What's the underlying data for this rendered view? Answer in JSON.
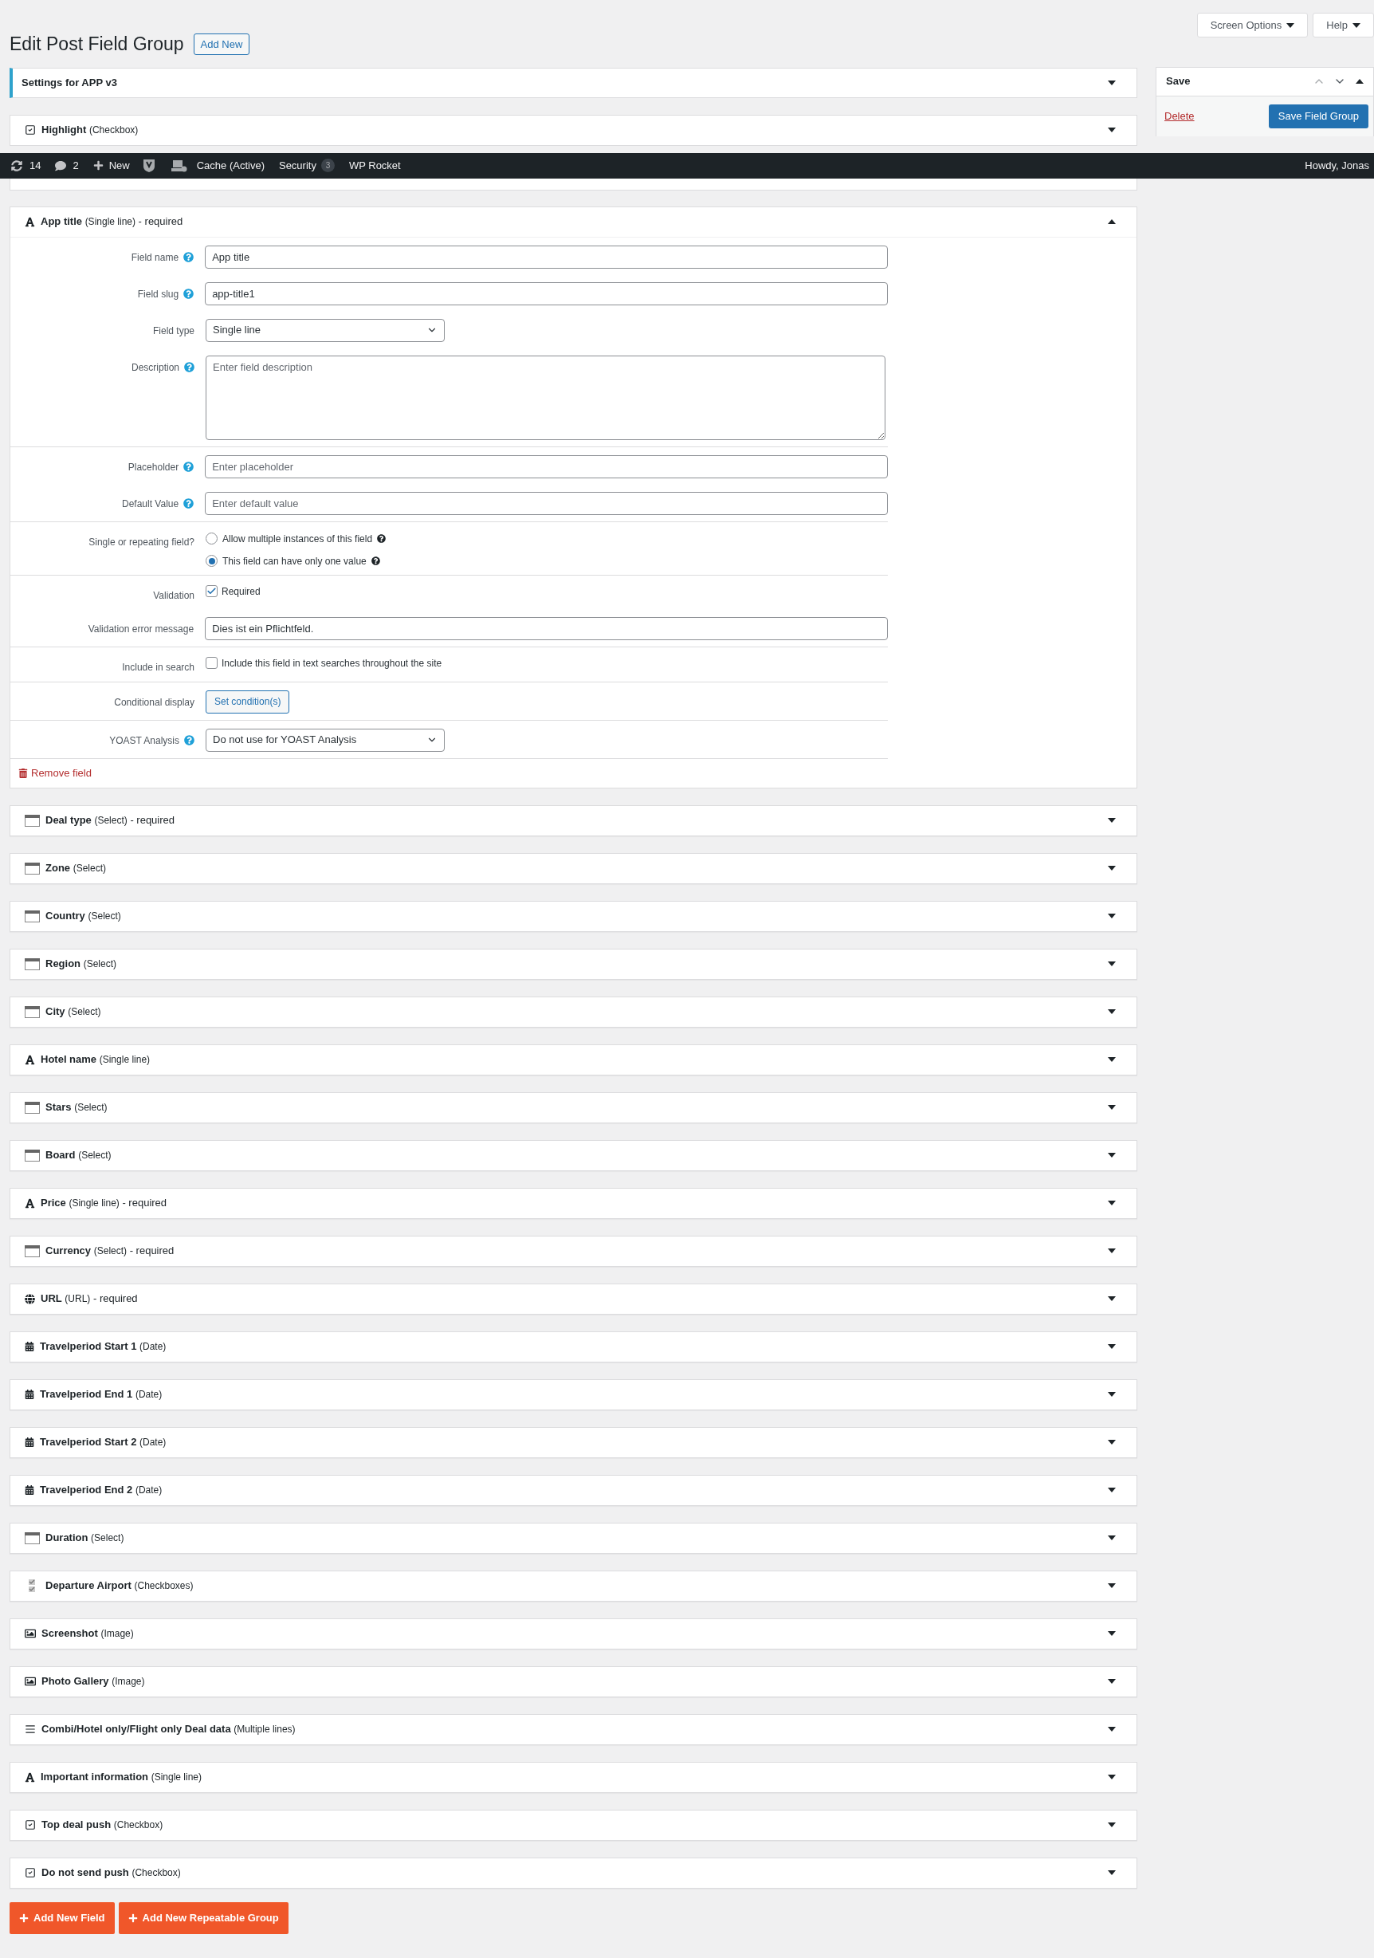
{
  "screen_meta": {
    "screen_options": "Screen Options",
    "help": "Help"
  },
  "page_title": "Edit Post Field Group",
  "add_new": "Add New",
  "settings_box": {
    "title": "Settings for APP v3",
    "expanded": false
  },
  "top_fields": [
    {
      "kind": "checkbox",
      "name": "Highlight",
      "type": "(Checkbox)",
      "expanded": false
    }
  ],
  "save_box": {
    "title": "Save",
    "delete": "Delete",
    "button": "Save Field Group"
  },
  "admin_bar": {
    "updates": "14",
    "comments": "2",
    "new": "New",
    "cache": "Cache (Active)",
    "security": "Security",
    "security_count": "3",
    "rocket": "WP Rocket",
    "greeting": "Howdy, Jonas"
  },
  "active_field": {
    "kind": "text",
    "name": "App title",
    "type": "(Single line)",
    "suffix": "- required",
    "expanded": true,
    "groups": [
      [
        {
          "kind": "input",
          "label": "Field name",
          "help": true,
          "value": "App title"
        },
        {
          "kind": "input",
          "label": "Field slug",
          "help": true,
          "value": "app-title1"
        },
        {
          "kind": "select",
          "label": "Field type",
          "help": false,
          "value": "Single line"
        },
        {
          "kind": "textarea",
          "label": "Description",
          "help": true,
          "placeholder": "Enter field description"
        }
      ],
      [
        {
          "kind": "input",
          "label": "Placeholder",
          "help": true,
          "placeholder": "Enter placeholder"
        },
        {
          "kind": "input",
          "label": "Default Value",
          "help": true,
          "placeholder": "Enter default value"
        }
      ],
      [
        {
          "kind": "radios",
          "label": "Single or repeating field?",
          "help": false,
          "options": [
            {
              "label": "Allow multiple instances of this field",
              "help": true,
              "selected": false
            },
            {
              "label": "This field can have only one value",
              "help": true,
              "selected": true
            }
          ]
        }
      ],
      [
        {
          "kind": "checkbox",
          "label": "Validation",
          "help": false,
          "text": "Required",
          "checked": true
        },
        {
          "kind": "input",
          "label": "Validation error message",
          "help": false,
          "value": "Dies ist ein Pflichtfeld."
        }
      ],
      [
        {
          "kind": "checkbox",
          "label": "Include in search",
          "help": false,
          "text": "Include this field in text searches throughout the site",
          "checked": false
        }
      ],
      [
        {
          "kind": "button",
          "label": "Conditional display",
          "help": false,
          "text": "Set condition(s)"
        }
      ],
      [
        {
          "kind": "select",
          "label": "YOAST Analysis",
          "help": true,
          "value": "Do not use for YOAST Analysis"
        }
      ]
    ],
    "remove": "Remove field"
  },
  "fields": [
    {
      "kind": "select",
      "name": "Deal type",
      "type": "(Select)",
      "suffix": "- required",
      "expanded": false
    },
    {
      "kind": "select",
      "name": "Zone",
      "type": "(Select)",
      "expanded": false
    },
    {
      "kind": "select",
      "name": "Country",
      "type": "(Select)",
      "expanded": false
    },
    {
      "kind": "select",
      "name": "Region",
      "type": "(Select)",
      "expanded": false
    },
    {
      "kind": "select",
      "name": "City",
      "type": "(Select)",
      "expanded": false
    },
    {
      "kind": "text",
      "name": "Hotel name",
      "type": "(Single line)",
      "expanded": false
    },
    {
      "kind": "select",
      "name": "Stars",
      "type": "(Select)",
      "expanded": false
    },
    {
      "kind": "select",
      "name": "Board",
      "type": "(Select)",
      "expanded": false
    },
    {
      "kind": "text",
      "name": "Price",
      "type": "(Single line)",
      "suffix": "- required",
      "expanded": false
    },
    {
      "kind": "select",
      "name": "Currency",
      "type": "(Select)",
      "suffix": "- required",
      "expanded": false
    },
    {
      "kind": "url",
      "name": "URL",
      "type": "(URL)",
      "suffix": "- required",
      "expanded": false
    },
    {
      "kind": "date",
      "name": "Travelperiod Start 1",
      "type": "(Date)",
      "expanded": false
    },
    {
      "kind": "date",
      "name": "Travelperiod End 1",
      "type": "(Date)",
      "expanded": false
    },
    {
      "kind": "date",
      "name": "Travelperiod Start 2",
      "type": "(Date)",
      "expanded": false
    },
    {
      "kind": "date",
      "name": "Travelperiod End 2",
      "type": "(Date)",
      "expanded": false
    },
    {
      "kind": "select",
      "name": "Duration",
      "type": "(Select)",
      "expanded": false
    },
    {
      "kind": "checkboxes",
      "name": "Departure Airport",
      "type": "(Checkboxes)",
      "expanded": false
    },
    {
      "kind": "image",
      "name": "Screenshot",
      "type": "(Image)",
      "expanded": false
    },
    {
      "kind": "image",
      "name": "Photo Gallery",
      "type": "(Image)",
      "expanded": false
    },
    {
      "kind": "textarea",
      "name": "Combi/Hotel only/Flight only Deal data",
      "type": "(Multiple lines)",
      "expanded": false
    },
    {
      "kind": "text",
      "name": "Important information",
      "type": "(Single line)",
      "expanded": false
    },
    {
      "kind": "checkbox",
      "name": "Top deal push",
      "type": "(Checkbox)",
      "expanded": false
    },
    {
      "kind": "checkbox",
      "name": "Do not send push",
      "type": "(Checkbox)",
      "expanded": false
    }
  ],
  "buttons": [
    "Add New Field",
    "Add New Repeatable Group"
  ]
}
